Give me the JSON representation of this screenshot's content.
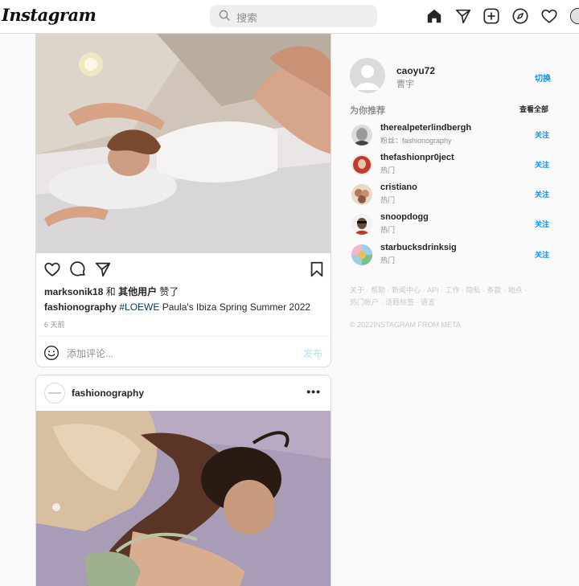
{
  "header": {
    "logo": "Instagram",
    "search_placeholder": "搜索",
    "icons": [
      "home-icon",
      "direct-icon",
      "new-post-icon",
      "explore-icon",
      "activity-icon",
      "profile-avatar"
    ]
  },
  "post1": {
    "likes_user": "marksonik18",
    "likes_rest": " 和 ",
    "likes_others": "其他用户",
    "likes_suffix": " 赞了",
    "caption_user": "fashionography",
    "caption_tag": "#LOEWE",
    "caption_text": " Paula's Ibiza Spring Summer 2022",
    "time": "6 天前",
    "comment_placeholder": "添加评论...",
    "post_label": "发布"
  },
  "post2": {
    "username": "fashionography",
    "more": "•••"
  },
  "sidebar": {
    "username": "caoyu72",
    "fullname": "曹宇",
    "switch_label": "切换",
    "suggestions_title": "为你推荐",
    "see_all": "查看全部",
    "suggestions": [
      {
        "username": "therealpeterlindbergh",
        "subtitle": "粉丝：fashionography",
        "follow": "关注"
      },
      {
        "username": "thefashionpr0ject",
        "subtitle": "热门",
        "follow": "关注"
      },
      {
        "username": "cristiano",
        "subtitle": "热门",
        "follow": "关注"
      },
      {
        "username": "snoopdogg",
        "subtitle": "热门",
        "follow": "关注"
      },
      {
        "username": "starbucksdrinksig",
        "subtitle": "热门",
        "follow": "关注"
      }
    ],
    "footer_line1": "关于 · 帮助 · 新闻中心 · API · 工作 · 隐私 · 条款 · 地点 ·",
    "footer_line2": "热门帐户 · 话题标签 · 语言",
    "copyright": "© 2022INSTAGRAM FROM META"
  },
  "colors": {
    "accent": "#0095f6",
    "link": "#00376b",
    "muted": "#8e8e8e",
    "border": "#dbdbdb"
  }
}
